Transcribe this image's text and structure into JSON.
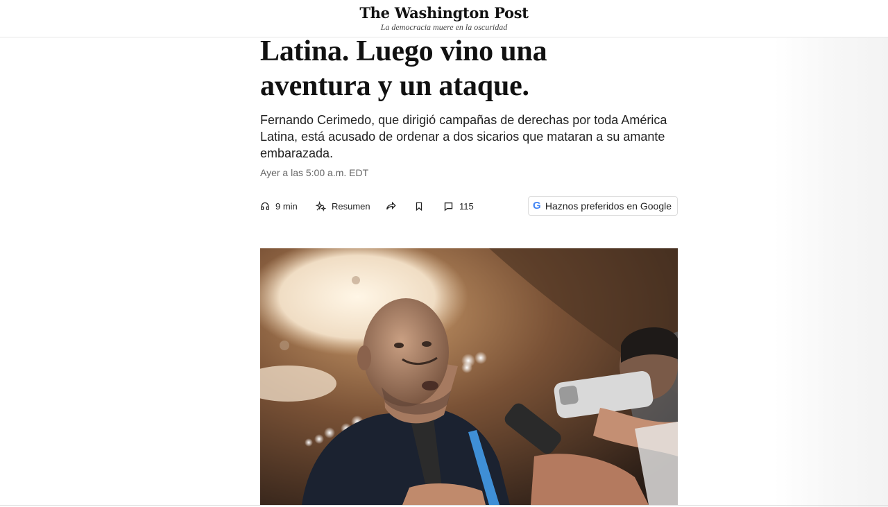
{
  "masthead": {
    "logo": "The Washington Post",
    "tagline": "La democracia muere en la oscuridad"
  },
  "article": {
    "headline_lines": [
      "Latina. Luego vino una",
      "aventura y un ataque."
    ],
    "dek": "Fernando Cerimedo, que dirigió campañas de derechas por toda América Latina, está acusado de ordenar a dos sicarios que mataran a su amante embarazada.",
    "timestamp": "Ayer a las 5:00 a.m. EDT"
  },
  "toolbar": {
    "listen_label": "9 min",
    "summary_label": "Resumen",
    "comments_count": "115",
    "google_label": "Haznos preferidos en Google",
    "google_glyph": "G"
  },
  "icons": {
    "listen": "headphones-icon",
    "summary": "sparkle-icon",
    "share": "share-arrow-icon",
    "bookmark": "bookmark-icon",
    "comments": "comment-icon",
    "google": "google-g-icon"
  },
  "colors": {
    "text": "#111111",
    "muted": "#666666",
    "google_blue": "#4285F4"
  }
}
